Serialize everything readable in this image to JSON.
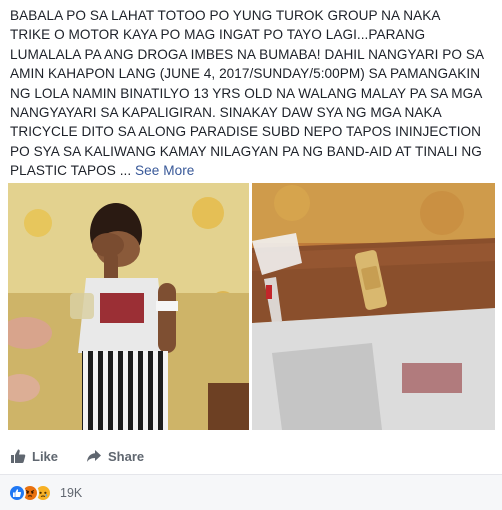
{
  "post": {
    "text_lines": [
      "BABALA PO SA LAHAT TOTOO PO YUNG TUROK GROUP NA NAKA",
      "TRIKE O MOTOR KAYA PO MAG INGAT PO TAYO LAGI...PARANG",
      "LUMALALA PA ANG DROGA IMBES NA BUMABA! DAHIL NANGYARI PO SA",
      "AMIN KAHAPON LANG (JUNE 4, 2017/SUNDAY/5:00PM) SA PAMANGAKIN",
      "NG LOLA NAMIN BINATILYO 13 YRS OLD NA WALANG MALAY PA SA MGA",
      "NANGYAYARI SA KAPALIGIRAN. SINAKAY DAW SYA NG MGA NAKA",
      "TRICYCLE DITO SA ALONG PARADISE SUBD NEPO TAPOS ININJECTION",
      "PO SYA SA KALIWANG KAMAY NILAGYAN PA NG BAND-AID AT TINALI NG",
      "PLASTIC TAPOS ... "
    ],
    "see_more_label": "See More"
  },
  "photos": [
    {
      "subject": "boy-covering-face-on-sofa"
    },
    {
      "subject": "arm-with-band-aid-closeup"
    }
  ],
  "actions": {
    "like_label": "Like",
    "share_label": "Share",
    "like_icon": "thumbs-up-icon",
    "share_icon": "share-arrow-icon"
  },
  "reactions": {
    "icons": [
      "like-reaction-icon",
      "angry-reaction-icon",
      "sad-reaction-icon"
    ],
    "count": "19K"
  },
  "colors": {
    "text": "#1d2129",
    "link": "#385898",
    "action_text": "#606770",
    "like_blue": "#2078f4",
    "angry": "#e9710f",
    "sad": "#f7b125",
    "footer_bg": "#f6f7f9"
  }
}
